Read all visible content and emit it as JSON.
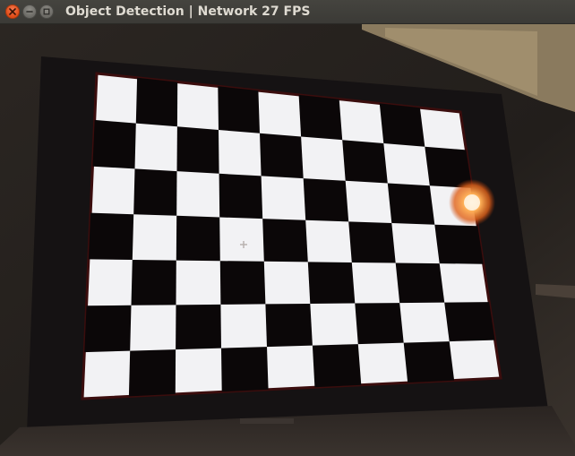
{
  "window": {
    "title": "Object Detection | Network 27 FPS",
    "close_icon": "close-icon",
    "minimize_icon": "minimize-icon",
    "maximize_icon": "maximize-icon"
  },
  "camera_view": {
    "content": "camera-feed-of-laptop-screen-showing-checkerboard",
    "crosshair_icon": "crosshair-icon",
    "board": {
      "columns": 9,
      "rows": 7
    },
    "colors": {
      "board_white": "#f2f2f4",
      "board_black": "#0b0708",
      "bezel": "#151213",
      "background": "#2a2420",
      "glare": "#ff9a3c"
    }
  }
}
